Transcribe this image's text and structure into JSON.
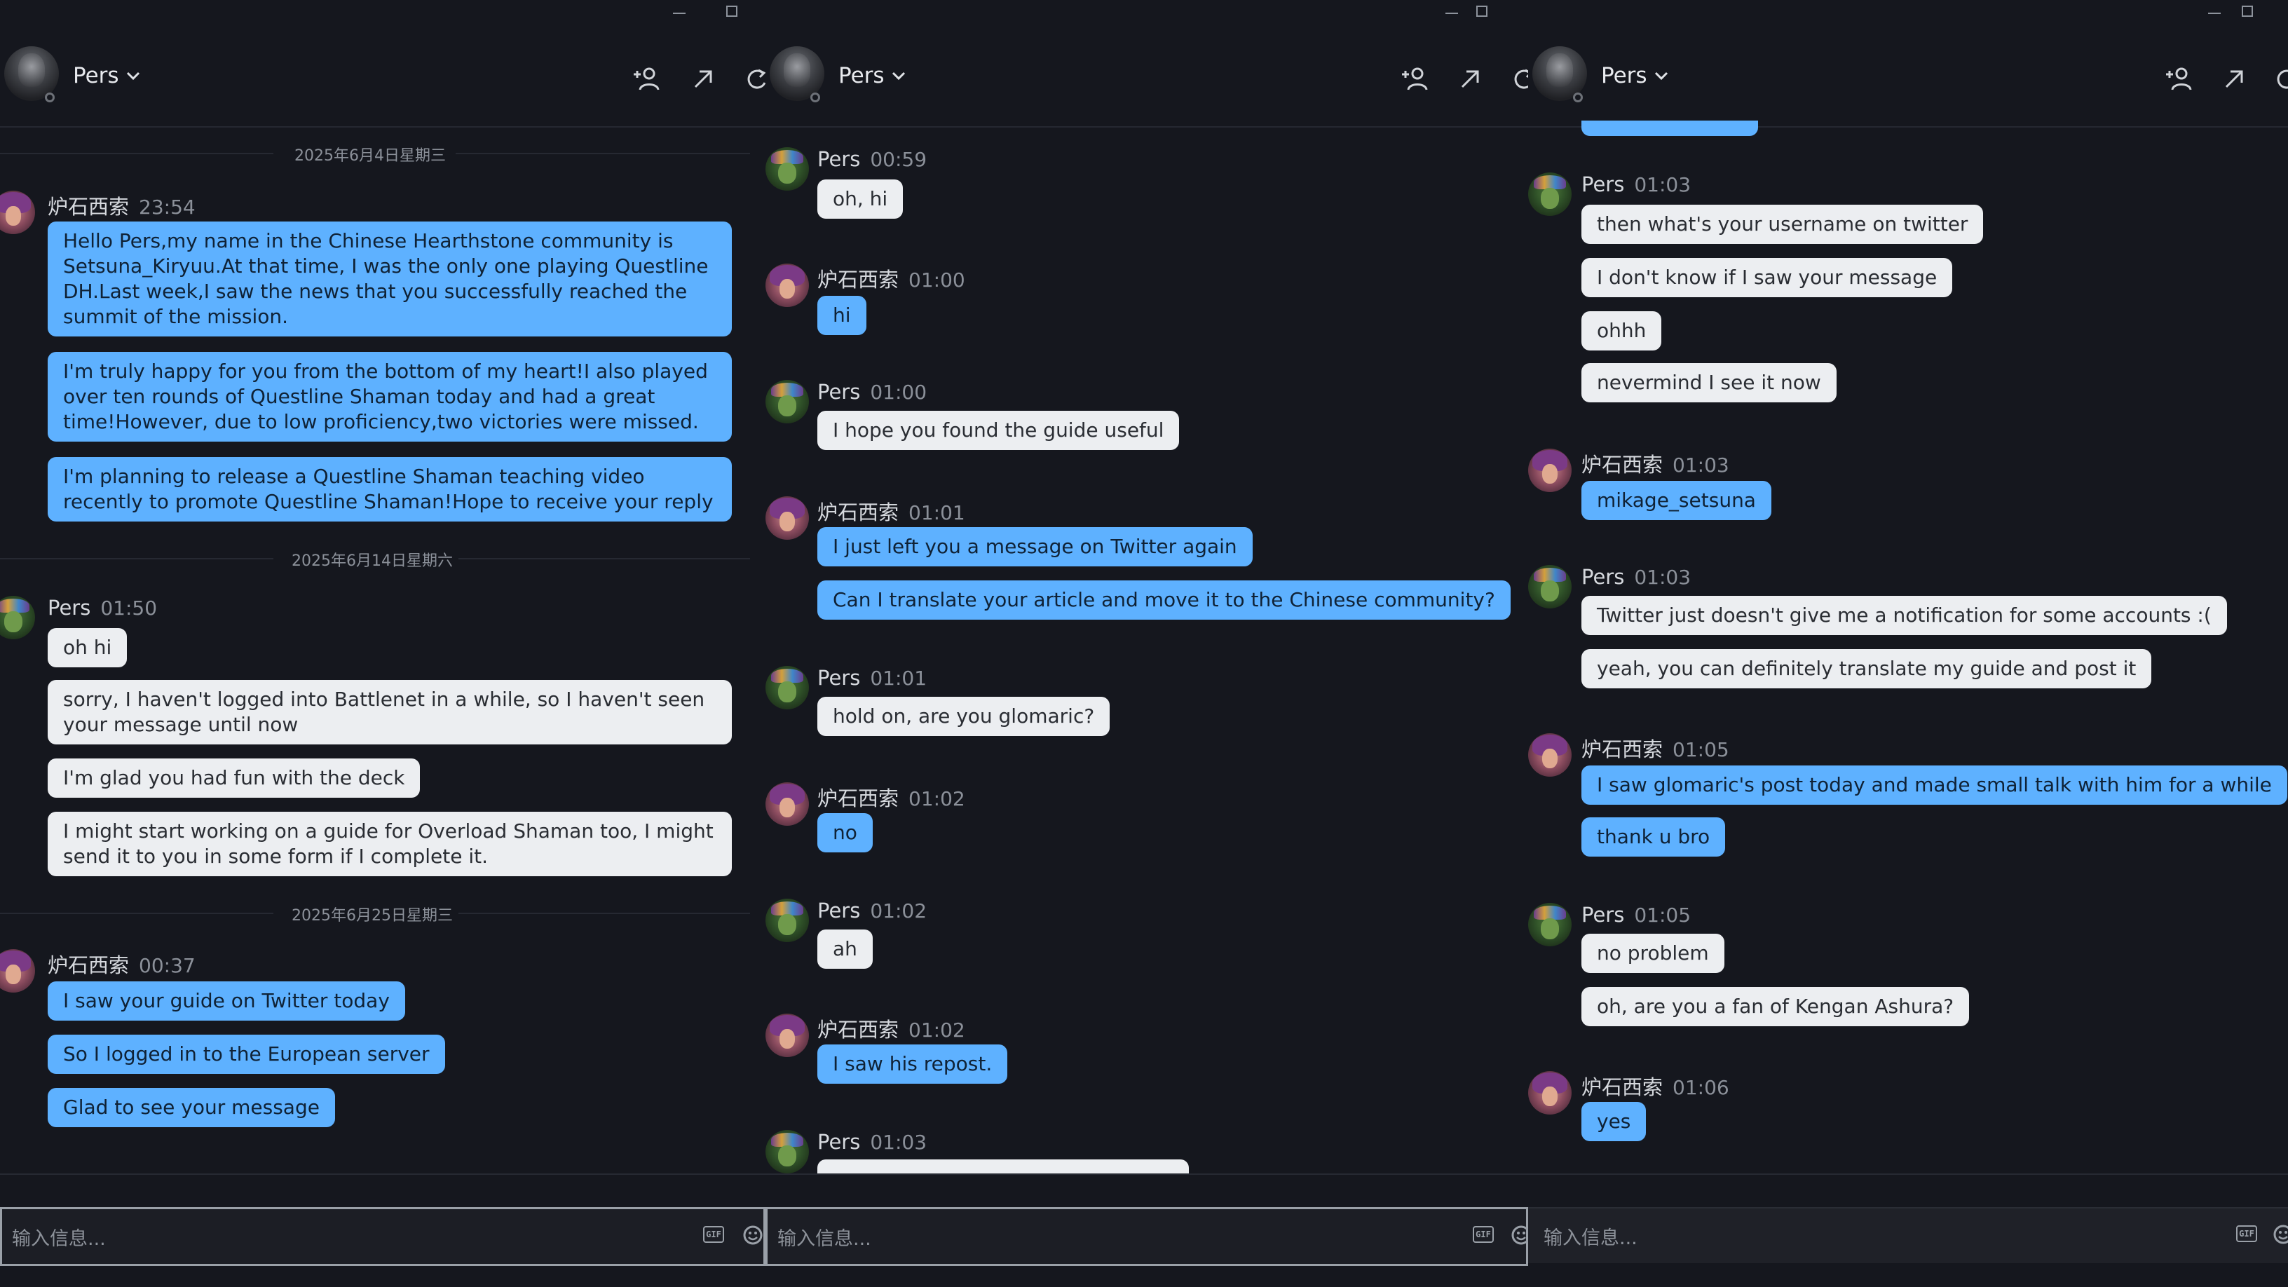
{
  "header": {
    "title": "Pers"
  },
  "input": {
    "placeholder": "输入信息...",
    "gif": "GIF"
  },
  "panel0": {
    "dates": [
      "2025年6月4日星期三",
      "2025年6月14日星期六",
      "2025年6月25日星期三"
    ],
    "g1": {
      "name": "炉石西索",
      "time": "23:54",
      "messages": [
        "Hello Pers,my name in the Chinese Hearthstone community is Setsuna_Kiryuu.At that time, I was the only one playing Questline DH.Last week,I saw the news that you successfully reached the summit of the mission.",
        "I'm truly happy for you from the bottom of my heart!I also played over ten rounds of Questline Shaman today and had a great time!However, due to low proficiency,two victories were missed.",
        "I'm planning to release a Questline Shaman teaching video recently to promote Questline Shaman!Hope to receive your reply"
      ]
    },
    "g2": {
      "name": "Pers",
      "time": "01:50",
      "messages": [
        "oh hi",
        "sorry, I haven't logged into Battlenet in a while, so I haven't seen your message until now",
        "I'm glad you had fun with the deck",
        "I might start working on a guide for Overload Shaman too, I might send it to you in some form if I complete it."
      ]
    },
    "g3": {
      "name": "炉石西索",
      "time": "00:37",
      "messages": [
        "I saw your guide on Twitter today",
        "So I logged in to the European server",
        "Glad to see your message"
      ]
    }
  },
  "panel1": {
    "g1": {
      "name": "Pers",
      "time": "00:59",
      "messages": [
        "oh, hi"
      ]
    },
    "g2": {
      "name": "炉石西索",
      "time": "01:00",
      "messages": [
        "hi"
      ]
    },
    "g3": {
      "name": "Pers",
      "time": "01:00",
      "messages": [
        "I hope you found the guide useful"
      ]
    },
    "g4": {
      "name": "炉石西索",
      "time": "01:01",
      "messages": [
        "I just left you a message on Twitter again",
        "Can I translate your article and move it to the Chinese community?"
      ]
    },
    "g5": {
      "name": "Pers",
      "time": "01:01",
      "messages": [
        "hold on, are you glomaric?"
      ]
    },
    "g6": {
      "name": "炉石西索",
      "time": "01:02",
      "messages": [
        "no"
      ]
    },
    "g7": {
      "name": "Pers",
      "time": "01:02",
      "messages": [
        "ah"
      ]
    },
    "g8": {
      "name": "炉石西索",
      "time": "01:02",
      "messages": [
        "I saw his repost."
      ]
    },
    "g9": {
      "name": "Pers",
      "time": "01:03",
      "messages": []
    }
  },
  "panel2": {
    "g1": {
      "name": "Pers",
      "time": "01:03",
      "messages": [
        "then what's your username on twitter",
        "I don't know if I saw your message",
        "ohhh",
        "nevermind I see it now"
      ]
    },
    "g2": {
      "name": "炉石西索",
      "time": "01:03",
      "messages": [
        "mikage_setsuna"
      ]
    },
    "g3": {
      "name": "Pers",
      "time": "01:03",
      "messages": [
        "Twitter just doesn't give me a notification for some accounts :(",
        "yeah, you can definitely translate my guide and post it"
      ]
    },
    "g4": {
      "name": "炉石西索",
      "time": "01:05",
      "messages": [
        "I saw glomaric's post today and made small talk with him for a while",
        "thank u bro"
      ]
    },
    "g5": {
      "name": "Pers",
      "time": "01:05",
      "messages": [
        "no problem",
        "oh, are you a fan of Kengan Ashura?"
      ]
    },
    "g6": {
      "name": "炉石西索",
      "time": "01:06",
      "messages": [
        "yes"
      ]
    }
  }
}
